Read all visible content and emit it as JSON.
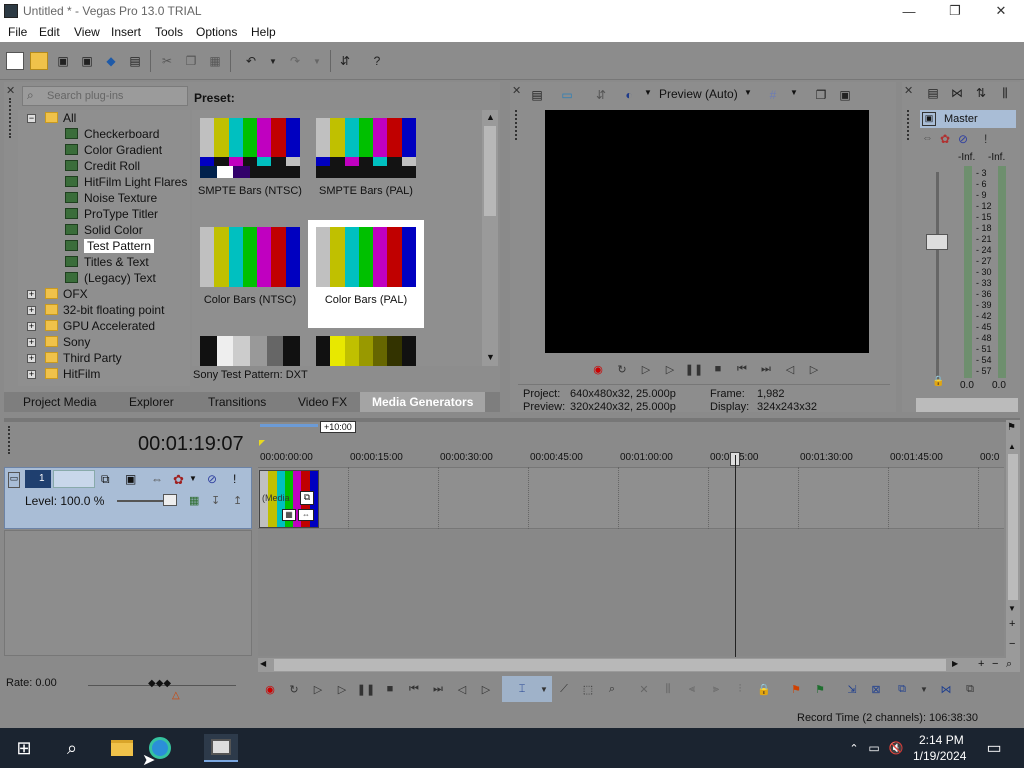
{
  "window": {
    "title": "Untitled * - Vegas Pro 13.0 TRIAL",
    "minimize": "—",
    "restore": "❐",
    "close": "✕"
  },
  "menu": [
    "File",
    "Edit",
    "View",
    "Insert",
    "Tools",
    "Options",
    "Help"
  ],
  "plugin_panel": {
    "search_placeholder": "Search plug-ins",
    "tree": [
      "All",
      "Checkerboard",
      "Color Gradient",
      "Credit Roll",
      "HitFilm Light Flares",
      "Noise Texture",
      "ProType Titler",
      "Solid Color",
      "Test Pattern",
      "Titles & Text",
      "(Legacy) Text",
      "OFX",
      "32-bit floating point",
      "GPU Accelerated",
      "Sony",
      "Third Party",
      "HitFilm"
    ],
    "preset_label": "Preset:",
    "presets": [
      "SMPTE Bars (NTSC)",
      "SMPTE Bars (PAL)",
      "Color Bars (NTSC)",
      "Color Bars (PAL)"
    ],
    "status": "Sony Test Pattern: DXT",
    "tabs": [
      "Project Media",
      "Explorer",
      "Transitions",
      "Video FX",
      "Media Generators"
    ]
  },
  "preview": {
    "quality": "Preview (Auto)",
    "project_label": "Project:",
    "project_value": "640x480x32, 25.000p",
    "preview_label": "Preview:",
    "preview_value": "320x240x32, 25.000p",
    "frame_label": "Frame:",
    "frame_value": "1,982",
    "display_label": "Display:",
    "display_value": "324x243x32"
  },
  "mixer": {
    "label": "Master",
    "left_inf": "-Inf.",
    "right_inf": "-Inf.",
    "scale": [
      "3",
      "6",
      "9",
      "12",
      "15",
      "18",
      "21",
      "24",
      "27",
      "30",
      "33",
      "36",
      "39",
      "42",
      "45",
      "48",
      "51",
      "54",
      "57"
    ],
    "left_val": "0.0",
    "right_val": "0.0"
  },
  "timeline": {
    "timecode": "00:01:19:07",
    "region": "+10:00",
    "ruler": [
      "00:00:00:00",
      "00:00:15:00",
      "00:00:30:00",
      "00:00:45:00",
      "00:01:00:00",
      "00:0",
      "5:00",
      "00:01:30:00",
      "00:01:45:00",
      "00:0"
    ],
    "track_number": "1",
    "level": "Level: 100.0 %",
    "clip_label": "(Media",
    "rate": "Rate: 0.00"
  },
  "status": {
    "record_time": "Record Time (2 channels): 106:38:30"
  },
  "taskbar": {
    "time": "2:14 PM",
    "date": "1/19/2024"
  },
  "colors": {
    "accent": "#a9bdd6",
    "window_bg": "#8a8a8a",
    "taskbar": "#1b2430"
  }
}
